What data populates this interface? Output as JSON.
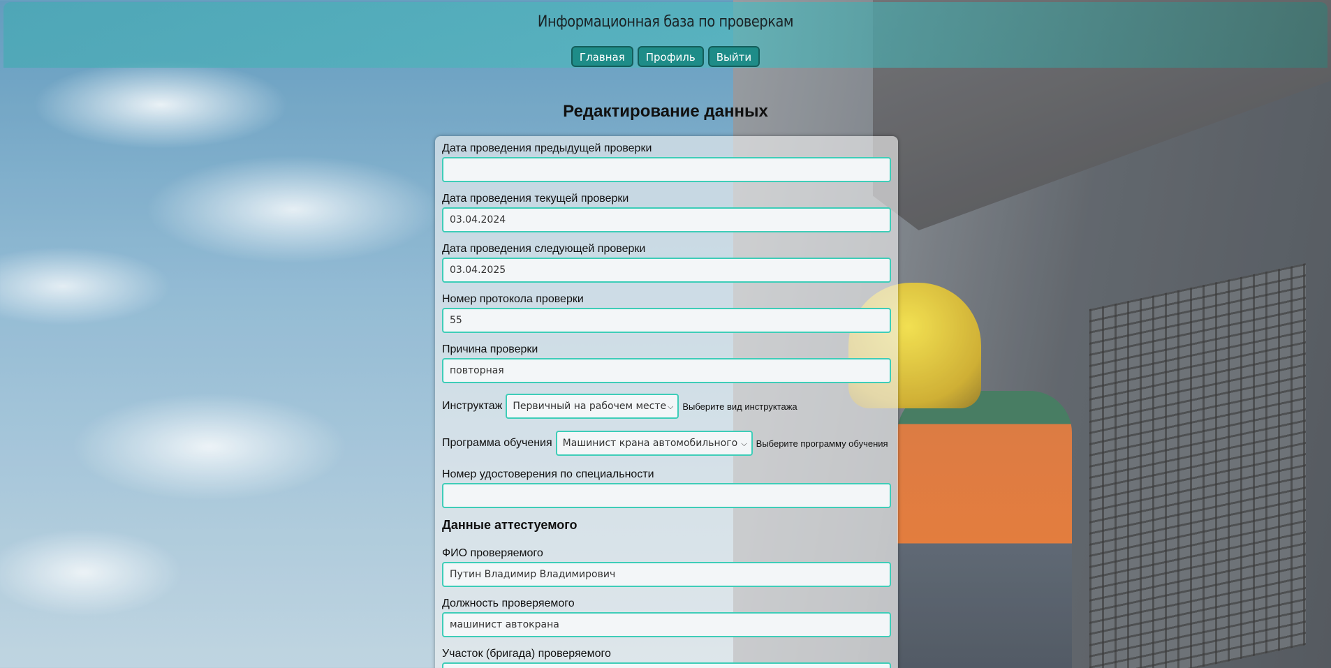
{
  "header": {
    "title": "Информационная база по проверкам",
    "nav": [
      {
        "label": "Главная"
      },
      {
        "label": "Профиль"
      },
      {
        "label": "Выйти"
      }
    ]
  },
  "page": {
    "title": "Редактирование данных"
  },
  "form": {
    "prev_check_date": {
      "label": "Дата проведения предыдущей проверки",
      "value": ""
    },
    "current_check_date": {
      "label": "Дата проведения текущей проверки",
      "value": "03.04.2024"
    },
    "next_check_date": {
      "label": "Дата проведения следующей проверки",
      "value": "03.04.2025"
    },
    "protocol_number": {
      "label": "Номер протокола проверки",
      "value": "55"
    },
    "check_reason": {
      "label": "Причина проверки",
      "value": "повторная"
    },
    "briefing": {
      "label": "Инструктаж",
      "selected": "Первичный на рабочем месте",
      "hint": "Выберите вид инструктажа"
    },
    "training_program": {
      "label": "Программа обучения",
      "selected": "Машинист крана автомобильного",
      "hint": "Выберите программу обучения"
    },
    "certificate_number": {
      "label": "Номер удостоверения по специальности",
      "value": ""
    },
    "examinee_section": {
      "title": "Данные аттестуемого"
    },
    "examinee_name": {
      "label": "ФИО проверяемого",
      "value": "Путин Владимир Владимирович"
    },
    "examinee_position": {
      "label": "Должность проверяемого",
      "value": "машинист автокрана"
    },
    "examinee_unit": {
      "label": "Участок (бригада) проверяемого",
      "value": ""
    }
  },
  "colors": {
    "nav_button": "#1e8c88",
    "input_border": "#3ecdb8"
  }
}
